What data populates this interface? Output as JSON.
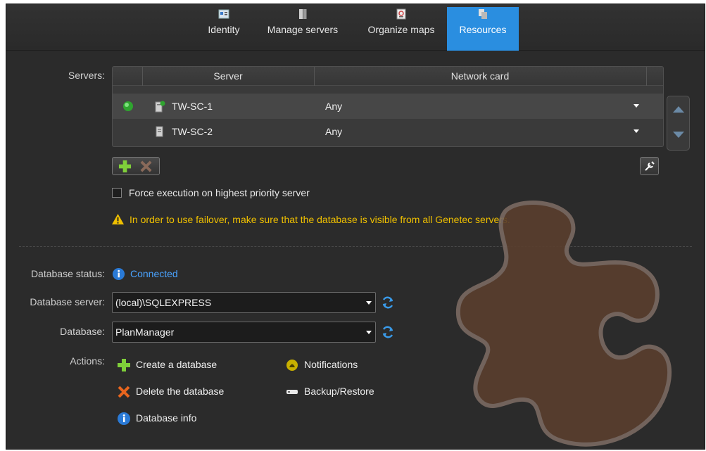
{
  "tabs": [
    {
      "label": "Identity",
      "icon": "identity-card-icon",
      "active": false
    },
    {
      "label": "Manage servers",
      "icon": "server-stack-icon",
      "active": false
    },
    {
      "label": "Organize maps",
      "icon": "map-document-icon",
      "active": false
    },
    {
      "label": "Resources",
      "icon": "resources-icon",
      "active": true
    }
  ],
  "servers": {
    "label": "Servers:",
    "columns": [
      "Server",
      "Network card"
    ],
    "rows": [
      {
        "status": "online",
        "name": "TW-SC-1",
        "network_card": "Any"
      },
      {
        "status": "",
        "name": "TW-SC-2",
        "network_card": "Any"
      }
    ]
  },
  "force_execution": {
    "label": "Force execution on highest priority server",
    "checked": false
  },
  "warning": "In order to use failover, make sure that the database is visible from all Genetec servers.",
  "database": {
    "status_label": "Database status:",
    "status_value": "Connected",
    "server_label": "Database server:",
    "server_value": "(local)\\SQLEXPRESS",
    "db_label": "Database:",
    "db_value": "PlanManager"
  },
  "actions": {
    "label": "Actions:",
    "create": "Create a database",
    "delete": "Delete the database",
    "info": "Database info",
    "notifications": "Notifications",
    "backup": "Backup/Restore"
  },
  "colors": {
    "active_tab": "#2a8ee0",
    "warning_text": "#f0c000",
    "connected_text": "#4aa3ff",
    "background": "#2b2b2b"
  }
}
